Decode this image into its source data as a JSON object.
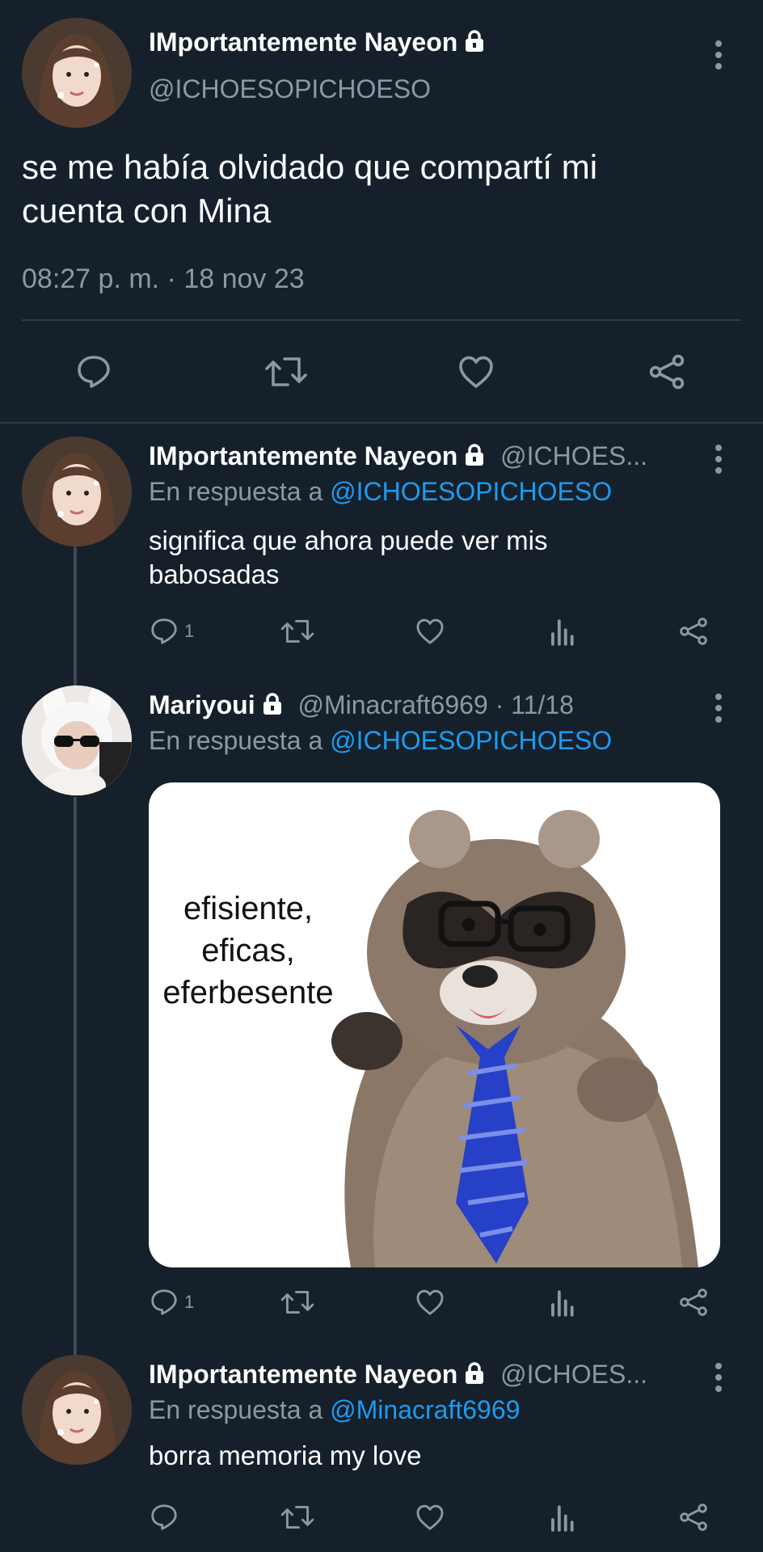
{
  "main_tweet": {
    "display_name": "IMportantemente Nayeon",
    "handle": "@ICHOESOPICHOESO",
    "text_line1": "se me había olvidado que compartí mi",
    "text_line2": "cuenta con Mina",
    "timestamp": "08:27 p. m. · 18 nov 23"
  },
  "replies": [
    {
      "display_name": "IMportantemente Nayeon",
      "handle": "@ICHOES...",
      "reply_prefix": "En respuesta a",
      "reply_to": "@ICHOESOPICHOESO",
      "text_line1": "significa que ahora puede ver mis",
      "text_line2": "babosadas",
      "reply_count": "1"
    },
    {
      "display_name": "Mariyoui",
      "handle": "@Minacraft6969 · 11/18",
      "reply_prefix": "En respuesta a",
      "reply_to": "@ICHOESOPICHOESO",
      "meme_text_1": "efisiente,",
      "meme_text_2": "eficas,",
      "meme_text_3": "eferbesente",
      "reply_count": "1"
    },
    {
      "display_name": "IMportantemente Nayeon",
      "handle": "@ICHOES...",
      "reply_prefix": "En respuesta a",
      "reply_to": "@Minacraft6969",
      "text_line1": "borra memoria my love"
    }
  ],
  "colors": {
    "background": "#15202b",
    "accent": "#1d9bf0",
    "muted": "#8b98a5",
    "divider": "#2f3b47"
  },
  "icons": [
    "lock-icon",
    "more-icon",
    "reply-icon",
    "retweet-icon",
    "like-icon",
    "share-icon",
    "views-icon"
  ]
}
